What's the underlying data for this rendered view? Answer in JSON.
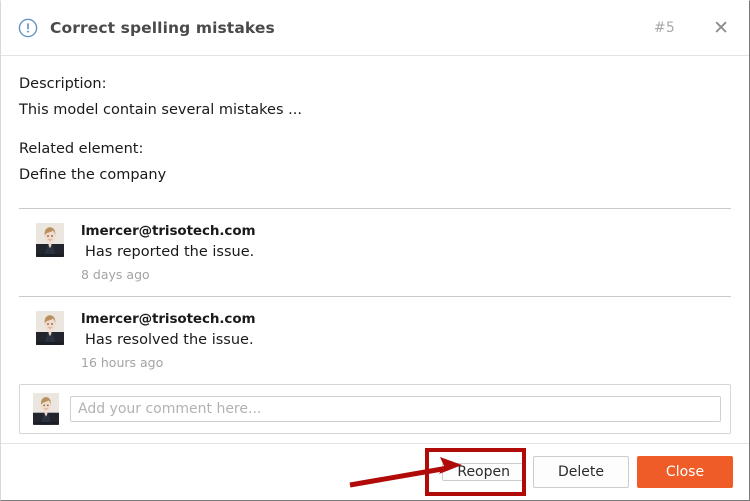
{
  "dialog": {
    "icon": "info-circle-icon",
    "title": "Correct spelling mistakes",
    "number": "#5",
    "close_icon": "close-icon",
    "accent_color": "#ef5c27",
    "icon_color": "#5b8ec4",
    "annotation_color": "#b00b09"
  },
  "details": {
    "description_label": "Description:",
    "description_value": "This model contain several mistakes ...",
    "related_label": "Related element:",
    "related_value": "Define the company"
  },
  "comments": [
    {
      "author": "lmercer@trisotech.com",
      "text": "Has reported the issue.",
      "time": "8 days ago",
      "avatar": "user-avatar"
    },
    {
      "author": "lmercer@trisotech.com",
      "text": "Has resolved the issue.",
      "time": "16 hours ago",
      "avatar": "user-avatar"
    }
  ],
  "new_comment": {
    "avatar": "user-avatar",
    "placeholder": "Add your comment here...",
    "value": ""
  },
  "footer": {
    "reopen_label": "Reopen",
    "delete_label": "Delete",
    "close_label": "Close"
  }
}
